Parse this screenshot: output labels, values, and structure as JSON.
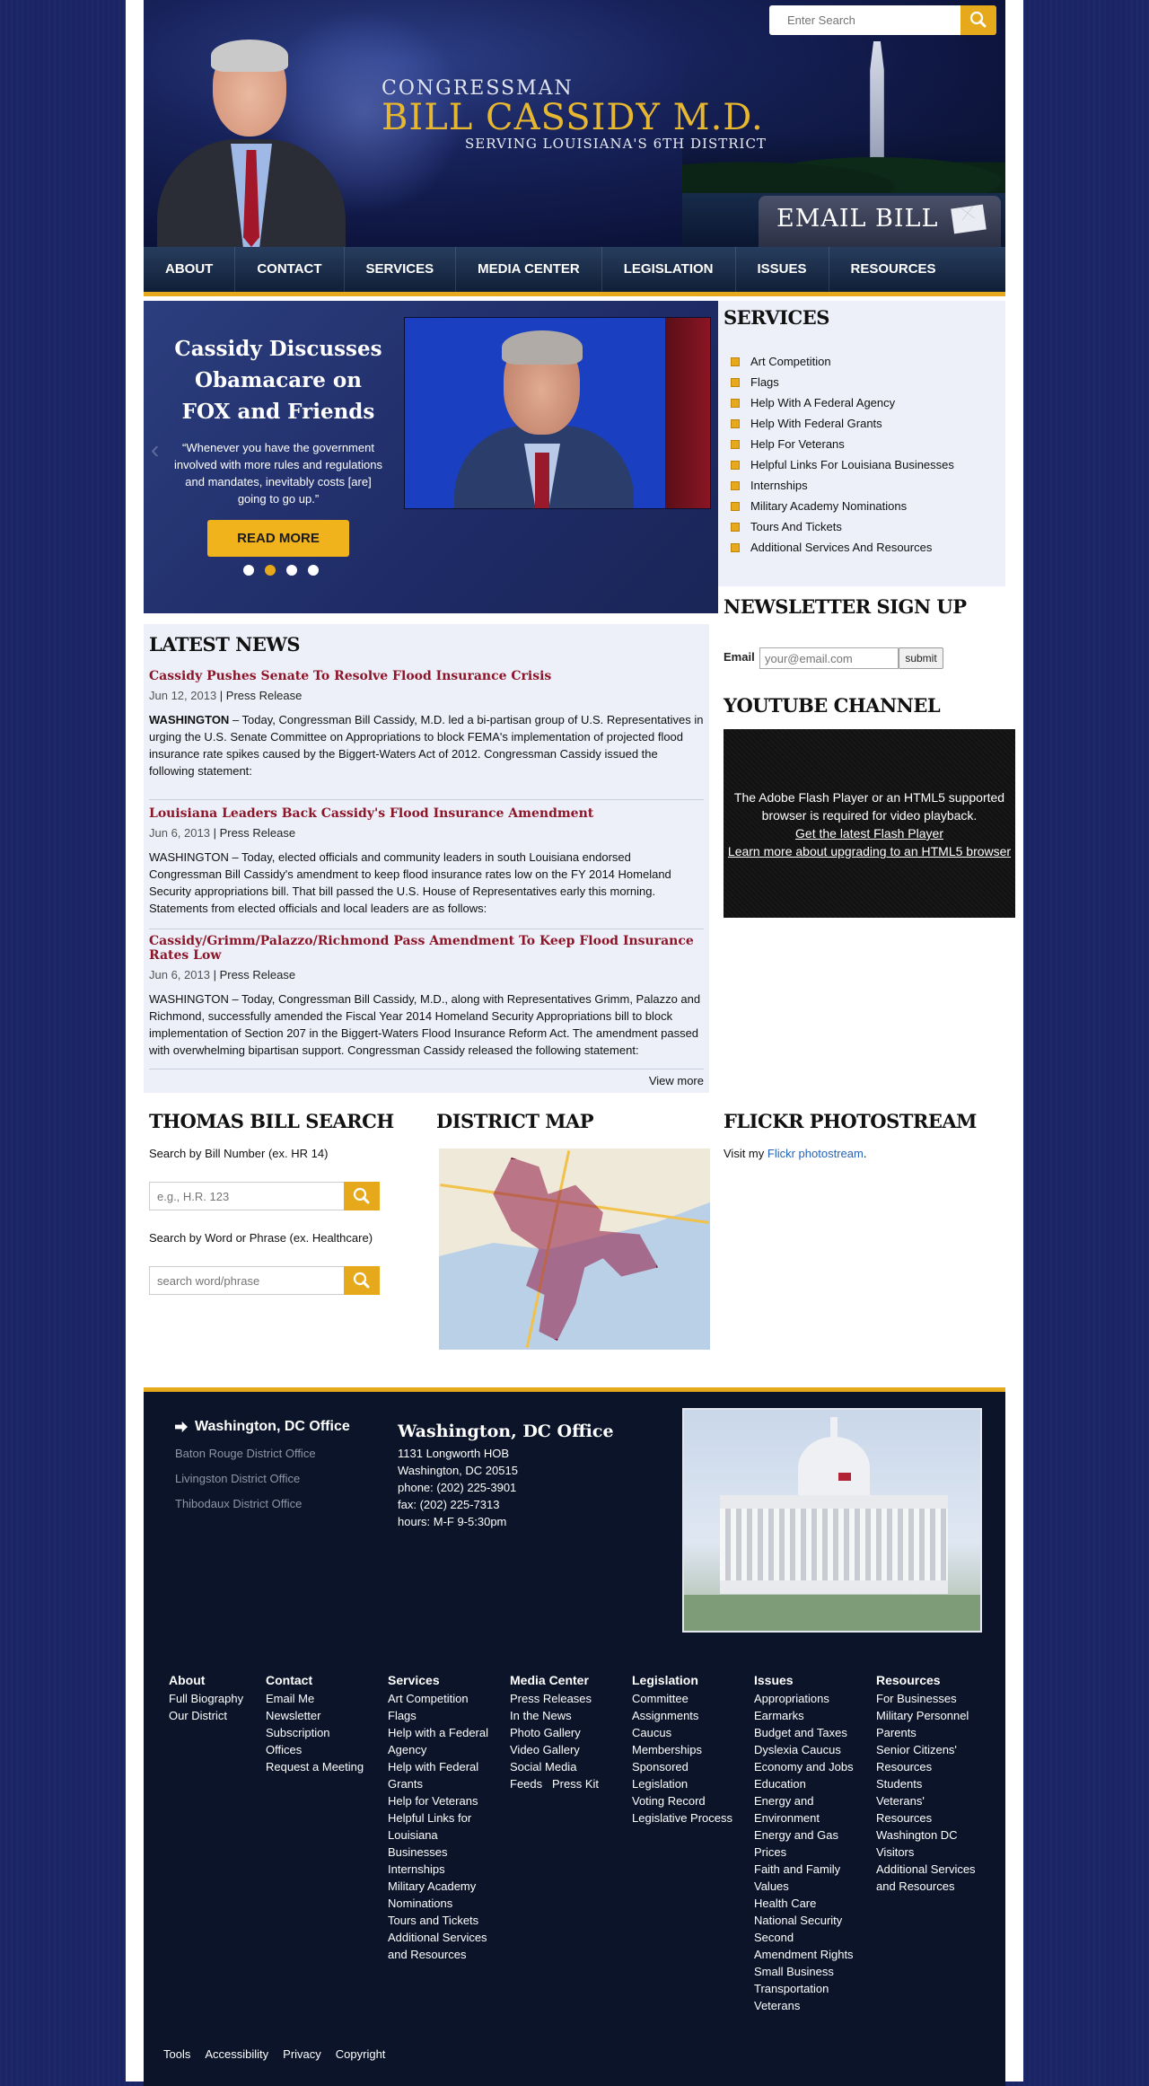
{
  "header": {
    "brand_line1": "CONGRESSMAN",
    "brand_line2": "BILL CASSIDY M.D.",
    "brand_line3": "SERVING LOUISIANA'S 6TH DISTRICT",
    "search_placeholder": "Enter Search",
    "email_button": "EMAIL BILL"
  },
  "nav": [
    "ABOUT",
    "CONTACT",
    "SERVICES",
    "MEDIA CENTER",
    "LEGISLATION",
    "ISSUES",
    "RESOURCES"
  ],
  "slider": {
    "title": "Cassidy Discusses Obamacare on FOX and Friends",
    "quote": "“Whenever you have the government involved with more rules and regulations and mandates, inevitably costs [are] going to go up.”",
    "button": "READ MORE",
    "active_dot": 2,
    "dot_count": 4
  },
  "services": {
    "title": "SERVICES",
    "items": [
      "Art Competition",
      "Flags",
      "Help With A Federal Agency",
      "Help With Federal Grants",
      "Help For Veterans",
      "Helpful Links For Louisiana Businesses",
      "Internships",
      "Military Academy Nominations",
      "Tours And Tickets",
      "Additional Services And Resources"
    ]
  },
  "newsletter": {
    "title": "NEWSLETTER SIGN UP",
    "label": "Email",
    "placeholder": "your@email.com",
    "button": "submit"
  },
  "youtube": {
    "title": "YOUTUBE CHANNEL",
    "message": "The Adobe Flash Player or an HTML5 supported browser is required for video playback.",
    "link1": "Get the latest Flash Player",
    "link2": "Learn more about upgrading to an HTML5 browser"
  },
  "news": {
    "title": "LATEST NEWS",
    "view_more": "View more",
    "articles": [
      {
        "headline": "Cassidy Pushes Senate To Resolve Flood Insurance Crisis",
        "date": "Jun 12, 2013",
        "type": "Press Release",
        "lead": "WASHINGTON",
        "body": " – Today, Congressman Bill Cassidy, M.D. led a bi-partisan group of U.S. Representatives in urging the U.S. Senate Committee on Appropriations to block FEMA's implementation of projected flood insurance rate spikes caused by the Biggert-Waters Act of 2012.  Congressman Cassidy issued the following statement:"
      },
      {
        "headline": "Louisiana Leaders Back Cassidy's Flood Insurance Amendment",
        "date": "Jun 6, 2013",
        "type": "Press Release",
        "lead": "",
        "body": "WASHINGTON – Today, elected officials and community leaders in south Louisiana endorsed Congressman Bill Cassidy's amendment to keep flood insurance rates low on the FY 2014 Homeland Security appropriations bill. That bill passed the U.S. House of Representatives early this morning. Statements from elected officials and local leaders are as follows:"
      },
      {
        "headline": "Cassidy/Grimm/Palazzo/Richmond Pass Amendment To Keep Flood Insurance Rates Low",
        "date": "Jun 6, 2013",
        "type": "Press Release",
        "lead": "",
        "body": "WASHINGTON – Today, Congressman Bill Cassidy, M.D., along with Representatives Grimm, Palazzo and Richmond, successfully amended the Fiscal Year 2014 Homeland Security Appropriations bill to block implementation of Section 207 in the Biggert-Waters Flood Insurance Reform Act. The amendment passed with overwhelming bipartisan support. Congressman Cassidy released the following statement:"
      }
    ]
  },
  "thomas": {
    "title": "THOMAS BILL SEARCH",
    "label1": "Search by Bill Number (ex. HR 14)",
    "placeholder1": "e.g., H.R. 123",
    "label2": "Search by Word or Phrase (ex. Healthcare)",
    "placeholder2": "search word/phrase"
  },
  "district_map": {
    "title": "DISTRICT MAP"
  },
  "flickr": {
    "title": "FLICKR PHOTOSTREAM",
    "prefix": "Visit my ",
    "link": "Flickr photostream",
    "suffix": "."
  },
  "footer": {
    "offices": [
      "Washington, DC Office",
      "Baton Rouge District Office",
      "Livingston District Office",
      "Thibodaux District Office"
    ],
    "detail": {
      "title": "Washington, DC Office",
      "lines": [
        "1131 Longworth HOB",
        "Washington, DC 20515",
        "phone: (202) 225-3901",
        "fax: (202) 225-7313",
        "hours: M-F 9-5:30pm"
      ]
    },
    "columns": [
      {
        "title": "About",
        "items": [
          "Full Biography",
          "Our District"
        ]
      },
      {
        "title": "Contact",
        "items": [
          "Email Me",
          "Newsletter Subscription",
          "Offices",
          "Request a Meeting"
        ]
      },
      {
        "title": "Services",
        "items": [
          "Art Competition",
          "Flags",
          "Help with a Federal Agency",
          "Help with Federal Grants",
          "Help for Veterans",
          "Helpful Links for Louisiana Businesses",
          "Internships",
          "Military Academy Nominations",
          "Tours and Tickets",
          "Additional Services and Resources"
        ]
      },
      {
        "title": "Media Center",
        "items": [
          "Press Releases",
          "In the News",
          "Photo Gallery",
          "Video Gallery",
          "Social Media Feeds",
          "Press Kit"
        ]
      },
      {
        "title": "Legislation",
        "items": [
          "Committee Assignments",
          "Caucus Memberships",
          "Sponsored Legislation",
          "Voting Record",
          "Legislative Process"
        ]
      },
      {
        "title": "Issues",
        "items": [
          "Appropriations Earmarks",
          "Budget and Taxes",
          "Dyslexia Caucus",
          "Economy and Jobs",
          "Education",
          "Energy and Environment",
          "Energy and Gas Prices",
          "Faith and Family Values",
          "Health Care",
          "National Security",
          "Second Amendment Rights",
          "Small Business",
          "Transportation",
          "Veterans"
        ]
      },
      {
        "title": "Resources",
        "items": [
          "For Businesses",
          "Military Personnel",
          "Parents",
          "Senior Citizens' Resources",
          "Students",
          "Veterans' Resources",
          "Washington DC Visitors",
          "Additional Services and Resources"
        ]
      }
    ],
    "bottom_links": [
      "Tools",
      "Accessibility",
      "Privacy",
      "Copyright"
    ]
  },
  "colors": {
    "accent": "#e6a91b",
    "headline": "#8c1528",
    "footer_bg": "#0b1428",
    "page_bg": "#1a2566"
  }
}
